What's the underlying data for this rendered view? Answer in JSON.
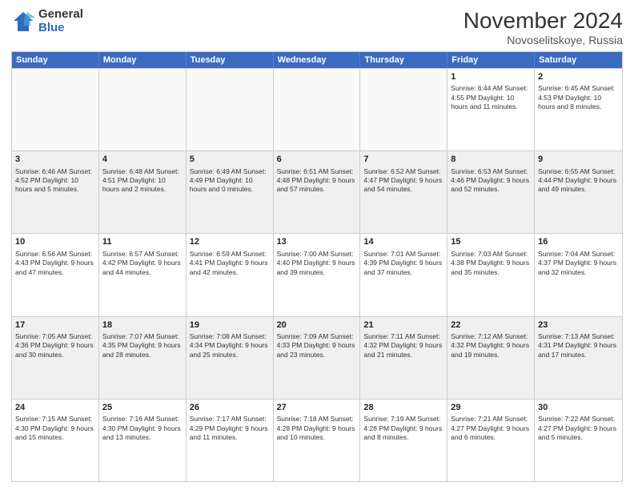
{
  "logo": {
    "general": "General",
    "blue": "Blue"
  },
  "title": {
    "month_year": "November 2024",
    "location": "Novoselitskoye, Russia"
  },
  "days_of_week": [
    "Sunday",
    "Monday",
    "Tuesday",
    "Wednesday",
    "Thursday",
    "Friday",
    "Saturday"
  ],
  "weeks": [
    [
      {
        "day": "",
        "info": ""
      },
      {
        "day": "",
        "info": ""
      },
      {
        "day": "",
        "info": ""
      },
      {
        "day": "",
        "info": ""
      },
      {
        "day": "",
        "info": ""
      },
      {
        "day": "1",
        "info": "Sunrise: 6:44 AM\nSunset: 4:55 PM\nDaylight: 10 hours and 11 minutes."
      },
      {
        "day": "2",
        "info": "Sunrise: 6:45 AM\nSunset: 4:53 PM\nDaylight: 10 hours and 8 minutes."
      }
    ],
    [
      {
        "day": "3",
        "info": "Sunrise: 6:46 AM\nSunset: 4:52 PM\nDaylight: 10 hours and 5 minutes."
      },
      {
        "day": "4",
        "info": "Sunrise: 6:48 AM\nSunset: 4:51 PM\nDaylight: 10 hours and 2 minutes."
      },
      {
        "day": "5",
        "info": "Sunrise: 6:49 AM\nSunset: 4:49 PM\nDaylight: 10 hours and 0 minutes."
      },
      {
        "day": "6",
        "info": "Sunrise: 6:51 AM\nSunset: 4:48 PM\nDaylight: 9 hours and 57 minutes."
      },
      {
        "day": "7",
        "info": "Sunrise: 6:52 AM\nSunset: 4:47 PM\nDaylight: 9 hours and 54 minutes."
      },
      {
        "day": "8",
        "info": "Sunrise: 6:53 AM\nSunset: 4:46 PM\nDaylight: 9 hours and 52 minutes."
      },
      {
        "day": "9",
        "info": "Sunrise: 6:55 AM\nSunset: 4:44 PM\nDaylight: 9 hours and 49 minutes."
      }
    ],
    [
      {
        "day": "10",
        "info": "Sunrise: 6:56 AM\nSunset: 4:43 PM\nDaylight: 9 hours and 47 minutes."
      },
      {
        "day": "11",
        "info": "Sunrise: 6:57 AM\nSunset: 4:42 PM\nDaylight: 9 hours and 44 minutes."
      },
      {
        "day": "12",
        "info": "Sunrise: 6:59 AM\nSunset: 4:41 PM\nDaylight: 9 hours and 42 minutes."
      },
      {
        "day": "13",
        "info": "Sunrise: 7:00 AM\nSunset: 4:40 PM\nDaylight: 9 hours and 39 minutes."
      },
      {
        "day": "14",
        "info": "Sunrise: 7:01 AM\nSunset: 4:39 PM\nDaylight: 9 hours and 37 minutes."
      },
      {
        "day": "15",
        "info": "Sunrise: 7:03 AM\nSunset: 4:38 PM\nDaylight: 9 hours and 35 minutes."
      },
      {
        "day": "16",
        "info": "Sunrise: 7:04 AM\nSunset: 4:37 PM\nDaylight: 9 hours and 32 minutes."
      }
    ],
    [
      {
        "day": "17",
        "info": "Sunrise: 7:05 AM\nSunset: 4:36 PM\nDaylight: 9 hours and 30 minutes."
      },
      {
        "day": "18",
        "info": "Sunrise: 7:07 AM\nSunset: 4:35 PM\nDaylight: 9 hours and 28 minutes."
      },
      {
        "day": "19",
        "info": "Sunrise: 7:08 AM\nSunset: 4:34 PM\nDaylight: 9 hours and 25 minutes."
      },
      {
        "day": "20",
        "info": "Sunrise: 7:09 AM\nSunset: 4:33 PM\nDaylight: 9 hours and 23 minutes."
      },
      {
        "day": "21",
        "info": "Sunrise: 7:11 AM\nSunset: 4:32 PM\nDaylight: 9 hours and 21 minutes."
      },
      {
        "day": "22",
        "info": "Sunrise: 7:12 AM\nSunset: 4:32 PM\nDaylight: 9 hours and 19 minutes."
      },
      {
        "day": "23",
        "info": "Sunrise: 7:13 AM\nSunset: 4:31 PM\nDaylight: 9 hours and 17 minutes."
      }
    ],
    [
      {
        "day": "24",
        "info": "Sunrise: 7:15 AM\nSunset: 4:30 PM\nDaylight: 9 hours and 15 minutes."
      },
      {
        "day": "25",
        "info": "Sunrise: 7:16 AM\nSunset: 4:30 PM\nDaylight: 9 hours and 13 minutes."
      },
      {
        "day": "26",
        "info": "Sunrise: 7:17 AM\nSunset: 4:29 PM\nDaylight: 9 hours and 11 minutes."
      },
      {
        "day": "27",
        "info": "Sunrise: 7:18 AM\nSunset: 4:28 PM\nDaylight: 9 hours and 10 minutes."
      },
      {
        "day": "28",
        "info": "Sunrise: 7:19 AM\nSunset: 4:28 PM\nDaylight: 9 hours and 8 minutes."
      },
      {
        "day": "29",
        "info": "Sunrise: 7:21 AM\nSunset: 4:27 PM\nDaylight: 9 hours and 6 minutes."
      },
      {
        "day": "30",
        "info": "Sunrise: 7:22 AM\nSunset: 4:27 PM\nDaylight: 9 hours and 5 minutes."
      }
    ]
  ]
}
